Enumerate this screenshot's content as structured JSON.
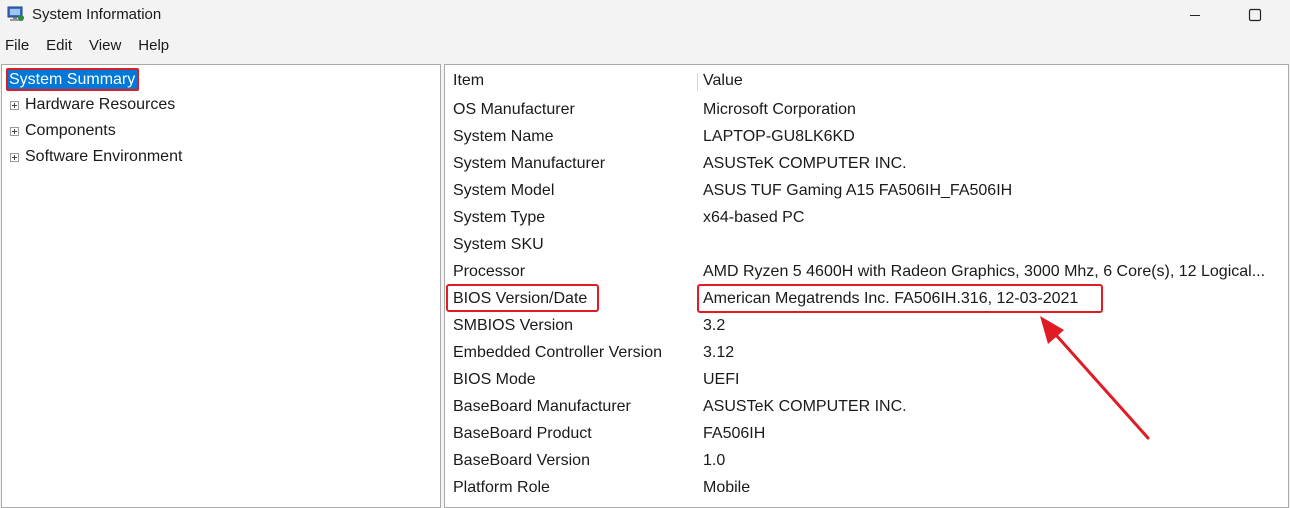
{
  "window": {
    "title": "System Information",
    "minimize_icon": "minimize-icon",
    "maximize_icon": "maximize-icon"
  },
  "menu": [
    "File",
    "Edit",
    "View",
    "Help"
  ],
  "tree": {
    "root": "System Summary",
    "children": [
      "Hardware Resources",
      "Components",
      "Software Environment"
    ]
  },
  "table": {
    "headers": {
      "item": "Item",
      "value": "Value"
    },
    "rows": [
      {
        "item": "OS Manufacturer",
        "value": "Microsoft Corporation"
      },
      {
        "item": "System Name",
        "value": "LAPTOP-GU8LK6KD"
      },
      {
        "item": "System Manufacturer",
        "value": "ASUSTeK COMPUTER INC."
      },
      {
        "item": "System Model",
        "value": "ASUS TUF Gaming A15 FA506IH_FA506IH"
      },
      {
        "item": "System Type",
        "value": "x64-based PC"
      },
      {
        "item": "System SKU",
        "value": ""
      },
      {
        "item": "Processor",
        "value": "AMD Ryzen 5 4600H with Radeon Graphics, 3000 Mhz, 6 Core(s), 12 Logical..."
      },
      {
        "item": "BIOS Version/Date",
        "value": "American Megatrends Inc. FA506IH.316, 12-03-2021"
      },
      {
        "item": "SMBIOS Version",
        "value": "3.2"
      },
      {
        "item": "Embedded Controller Version",
        "value": "3.12"
      },
      {
        "item": "BIOS Mode",
        "value": "UEFI"
      },
      {
        "item": "BaseBoard Manufacturer",
        "value": "ASUSTeK COMPUTER INC."
      },
      {
        "item": "BaseBoard Product",
        "value": "FA506IH"
      },
      {
        "item": "BaseBoard Version",
        "value": "1.0"
      },
      {
        "item": "Platform Role",
        "value": "Mobile"
      }
    ]
  },
  "colors": {
    "highlight_box": "#e01b24",
    "selection": "#0078d7"
  }
}
